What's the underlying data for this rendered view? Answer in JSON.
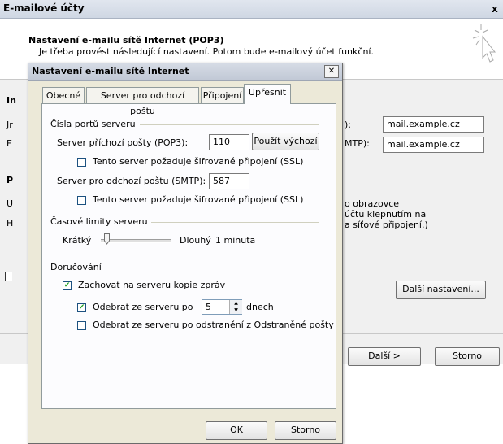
{
  "outer": {
    "title": "E-mailové účty",
    "close": "x",
    "heading": "Nastavení e-mailu sítě Internet (POP3)",
    "subheading": "Je třeba provést následující nastavení. Potom bude e-mailový účet funkční.",
    "frag_i": "In",
    "frag_j": "Jr",
    "frag_e": "E",
    "frag_p": "P",
    "frag_u": "U",
    "frag_h": "H",
    "frag_incoming_label": "):",
    "frag_smtp_label": "MTP):",
    "incoming_server_value": "mail.example.cz",
    "outgoing_server_value": "mail.example.cz",
    "desc_line1": "o obrazovce",
    "desc_line2": "účtu klepnutím na",
    "desc_line3": "a síťové připojení.)",
    "more_settings": "Další nastavení...",
    "next": "Další >",
    "cancel": "Storno"
  },
  "dialog": {
    "title": "Nastavení e-mailu sítě Internet",
    "close": "✕",
    "tabs": [
      "Obecné",
      "Server pro odchozí poštu",
      "Připojení",
      "Upřesnit"
    ],
    "active_tab": 3,
    "ports_group": "Čísla portů serveru",
    "pop3_label": "Server příchozí pošty (POP3):",
    "pop3_port": "110",
    "use_default": "Použít výchozí",
    "ssl_incoming_label": "Tento server požaduje šifrované připojení (SSL)",
    "ssl_incoming_checked": false,
    "smtp_label": "Server pro odchozí poštu (SMTP):",
    "smtp_port": "587",
    "ssl_outgoing_label": "Tento server požaduje šifrované připojení (SSL)",
    "ssl_outgoing_checked": false,
    "timeout_group": "Časové limity serveru",
    "timeout_short": "Krátký",
    "timeout_long": "Dlouhý",
    "timeout_value": "1 minuta",
    "timeout_level": 0.08,
    "delivery_group": "Doručování",
    "keep_copy_label": "Zachovat na serveru kopie zpráv",
    "keep_copy_checked": true,
    "remove_after_label": "Odebrat ze serveru po",
    "remove_after_checked": true,
    "remove_after_days": "5",
    "days_unit": "dnech",
    "remove_deleted_label": "Odebrat ze serveru po odstranění z Odstraněné pošty",
    "remove_deleted_checked": false,
    "ok": "OK",
    "cancel": "Storno"
  }
}
